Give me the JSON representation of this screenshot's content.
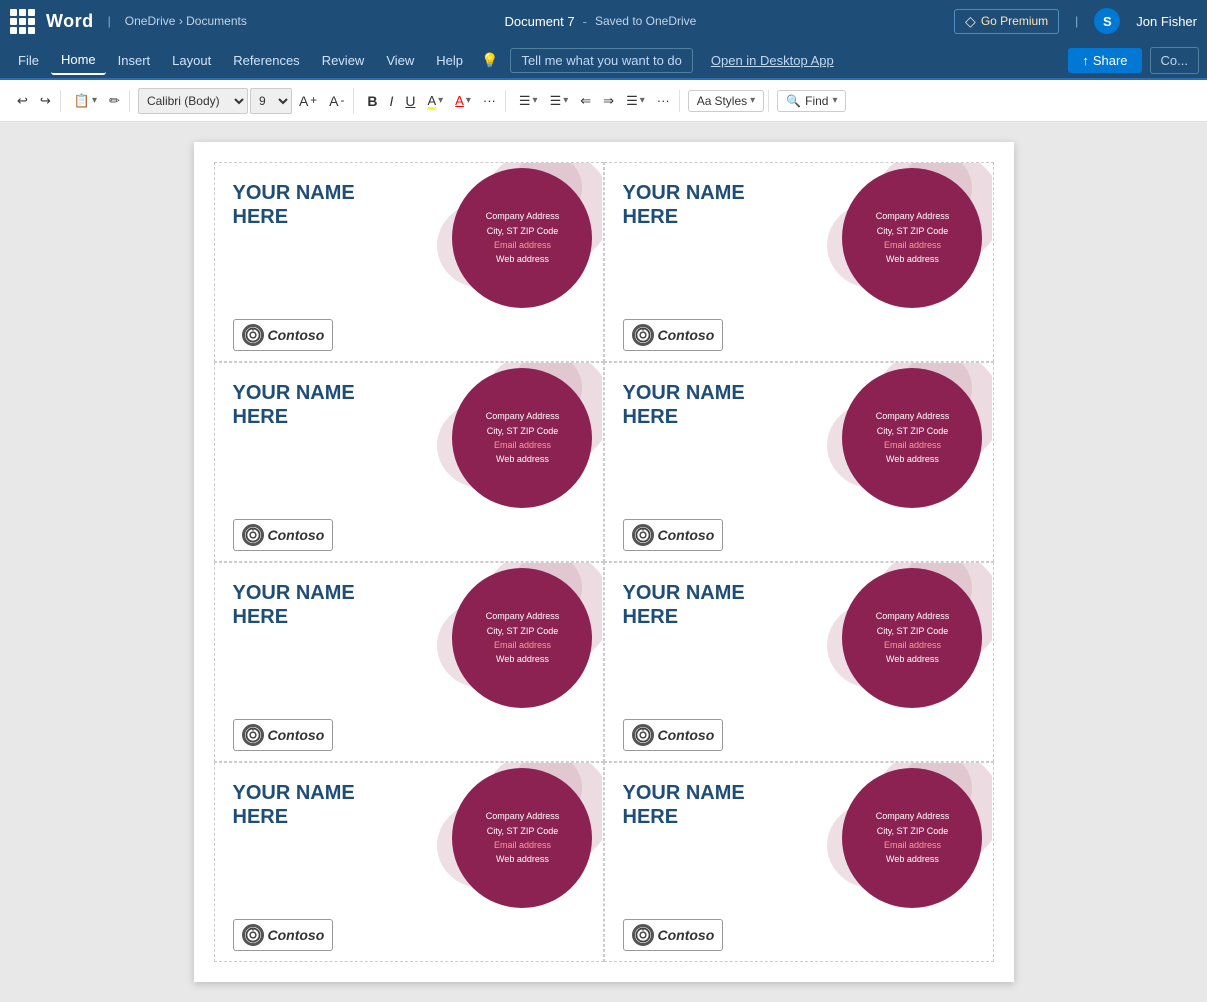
{
  "titlebar": {
    "app_name": "Word",
    "breadcrumb": "OneDrive › Documents",
    "doc_title": "Document 7",
    "separator": "-",
    "save_status": "Saved to OneDrive",
    "premium_label": "Go Premium",
    "user_name": "Jon Fisher",
    "skype_letter": "S"
  },
  "menubar": {
    "items": [
      {
        "label": "File",
        "active": false
      },
      {
        "label": "Home",
        "active": true
      },
      {
        "label": "Insert",
        "active": false
      },
      {
        "label": "Layout",
        "active": false
      },
      {
        "label": "References",
        "active": false
      },
      {
        "label": "Review",
        "active": false
      },
      {
        "label": "View",
        "active": false
      },
      {
        "label": "Help",
        "active": false
      }
    ],
    "tell_me": "Tell me what you want to do",
    "open_desktop": "Open in Desktop App",
    "share_label": "Share",
    "co_label": "Co..."
  },
  "toolbar": {
    "undo_label": "↩",
    "redo_label": "↪",
    "clipboard_label": "⧉",
    "format_painter": "✏",
    "font_family": "Calibri (Body)",
    "font_size": "9",
    "increase_font": "A↑",
    "decrease_font": "A↓",
    "bold": "B",
    "italic": "I",
    "underline": "U",
    "highlight": "A",
    "font_color": "A",
    "more_label": "···",
    "bullets": "☰",
    "numbering": "☰",
    "outdent": "⇐",
    "indent": "⇒",
    "align": "☰",
    "more2": "···",
    "styles_label": "Styles",
    "find_label": "Find"
  },
  "cards": [
    {
      "name_line1": "YOUR NAME",
      "name_line2": "HERE",
      "logo": "Contoso",
      "address_line1": "Company Address",
      "address_line2": "City, ST ZIP Code",
      "address_line3": "Email address",
      "address_line4": "Web address"
    },
    {
      "name_line1": "YOUR NAME",
      "name_line2": "HERE",
      "logo": "Contoso",
      "address_line1": "Company Address",
      "address_line2": "City, ST ZIP Code",
      "address_line3": "Email address",
      "address_line4": "Web address"
    },
    {
      "name_line1": "YOUR NAME",
      "name_line2": "HERE",
      "logo": "Contoso",
      "address_line1": "Company Address",
      "address_line2": "City, ST ZIP Code",
      "address_line3": "Email address",
      "address_line4": "Web address"
    },
    {
      "name_line1": "YOUR NAME",
      "name_line2": "HERE",
      "logo": "Contoso",
      "address_line1": "Company Address",
      "address_line2": "City, ST ZIP Code",
      "address_line3": "Email address",
      "address_line4": "Web address"
    },
    {
      "name_line1": "YOUR NAME",
      "name_line2": "HERE",
      "logo": "Contoso",
      "address_line1": "Company Address",
      "address_line2": "City, ST ZIP Code",
      "address_line3": "Email address",
      "address_line4": "Web address"
    },
    {
      "name_line1": "YOUR NAME",
      "name_line2": "HERE",
      "logo": "Contoso",
      "address_line1": "Company Address",
      "address_line2": "City, ST ZIP Code",
      "address_line3": "Email address",
      "address_line4": "Web address"
    },
    {
      "name_line1": "YOUR NAME",
      "name_line2": "HERE",
      "logo": "Contoso",
      "address_line1": "Company Address",
      "address_line2": "City, ST ZIP Code",
      "address_line3": "Email address",
      "address_line4": "Web address"
    },
    {
      "name_line1": "YOUR NAME",
      "name_line2": "HERE",
      "logo": "Contoso",
      "address_line1": "Company Address",
      "address_line2": "City, ST ZIP Code",
      "address_line3": "Email address",
      "address_line4": "Web address"
    }
  ],
  "colors": {
    "title_bar_bg": "#1e4d78",
    "accent_blue": "#0078d4",
    "card_name_color": "#1e4d78",
    "blob_color": "#8b2252",
    "blob_bg_color": "rgba(160,80,110,0.22)"
  }
}
